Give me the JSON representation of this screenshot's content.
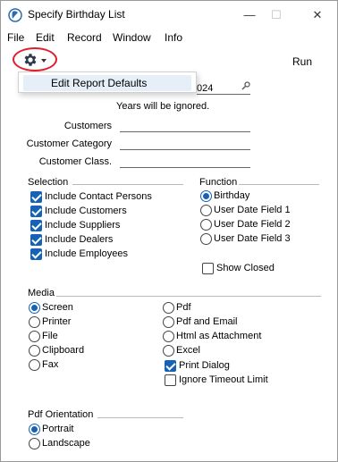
{
  "window": {
    "title": "Specify Birthday List",
    "minimize_glyph": "—",
    "maximize_glyph": "☐",
    "close_glyph": "✕"
  },
  "menu": [
    "File",
    "Edit",
    "Record",
    "Window",
    "Info"
  ],
  "toolbar": {
    "settings_icon": "gear-icon",
    "run_label": "Run",
    "annotation_color": "#e0202a"
  },
  "dropdown": {
    "items": [
      "Edit Report Defaults"
    ]
  },
  "form": {
    "period_value_partial": "024",
    "years_note": "Years will be ignored.",
    "fields": [
      {
        "label": "Customers",
        "value": ""
      },
      {
        "label": "Customer Category",
        "value": ""
      },
      {
        "label": "Customer Class.",
        "value": ""
      }
    ]
  },
  "selection": {
    "title": "Selection",
    "options": [
      {
        "label": "Include Contact Persons",
        "checked": true
      },
      {
        "label": "Include Customers",
        "checked": true
      },
      {
        "label": "Include Suppliers",
        "checked": true
      },
      {
        "label": "Include Dealers",
        "checked": true
      },
      {
        "label": "Include Employees",
        "checked": true
      }
    ]
  },
  "function": {
    "title": "Function",
    "options": [
      {
        "label": "Birthday",
        "selected": true
      },
      {
        "label": "User Date Field 1",
        "selected": false
      },
      {
        "label": "User Date Field 2",
        "selected": false
      },
      {
        "label": "User Date Field 3",
        "selected": false
      }
    ],
    "show_closed": {
      "label": "Show Closed",
      "checked": false
    }
  },
  "media": {
    "title": "Media",
    "left_options": [
      {
        "label": "Screen",
        "selected": true
      },
      {
        "label": "Printer",
        "selected": false
      },
      {
        "label": "File",
        "selected": false
      },
      {
        "label": "Clipboard",
        "selected": false
      },
      {
        "label": "Fax",
        "selected": false
      }
    ],
    "right_options": [
      {
        "label": "Pdf",
        "selected": false
      },
      {
        "label": "Pdf and Email",
        "selected": false
      },
      {
        "label": "Html as Attachment",
        "selected": false
      },
      {
        "label": "Excel",
        "selected": false
      }
    ],
    "print_dialog": {
      "label": "Print Dialog",
      "checked": true
    },
    "ignore_timeout": {
      "label": "Ignore Timeout Limit",
      "checked": false
    }
  },
  "orientation": {
    "title": "Pdf Orientation",
    "options": [
      {
        "label": "Portrait",
        "selected": true
      },
      {
        "label": "Landscape",
        "selected": false
      }
    ]
  },
  "colors": {
    "accent": "#1662b4",
    "menu_highlight": "#e6eef8"
  }
}
